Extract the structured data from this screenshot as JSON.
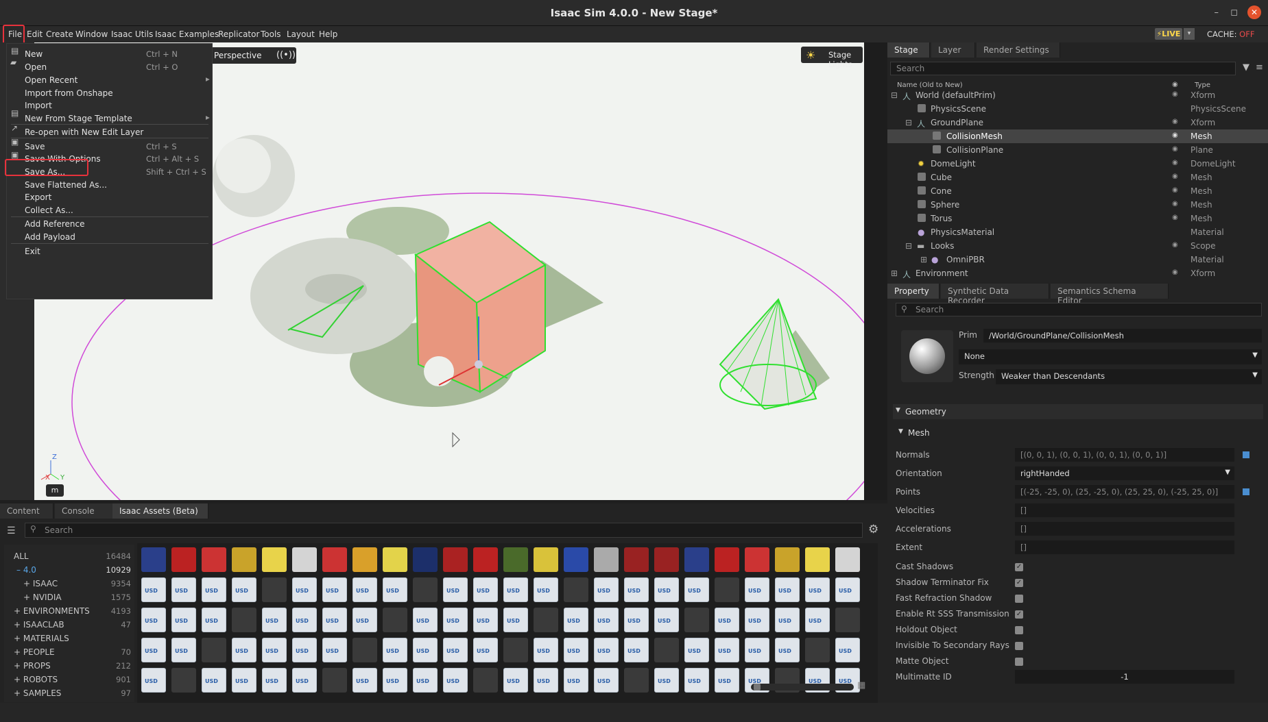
{
  "window": {
    "title": "Isaac Sim 4.0.0 - New Stage*",
    "min": "–",
    "max": "◻",
    "close": "✕"
  },
  "menubar": {
    "items": [
      "File",
      "Edit",
      "Create",
      "Window",
      "Isaac Utils",
      "Isaac Examples",
      "Replicator",
      "Tools",
      "Layout",
      "Help"
    ],
    "live": "⚡LIVE",
    "live_dd": "▾",
    "cache_label": "CACHE:",
    "cache_value": "OFF"
  },
  "file_menu": {
    "items": [
      {
        "label": "New",
        "shortcut": "Ctrl + N"
      },
      {
        "label": "Open",
        "shortcut": "Ctrl + O"
      },
      {
        "label": "Open Recent",
        "shortcut": "▸"
      },
      {
        "label": "Import from Onshape",
        "shortcut": ""
      },
      {
        "label": "Import",
        "shortcut": ""
      },
      {
        "label": "New From Stage Template",
        "shortcut": "▸"
      },
      {
        "label": "Re-open with New Edit Layer",
        "shortcut": ""
      },
      {
        "label": "Save",
        "shortcut": "Ctrl + S"
      },
      {
        "label": "Save With Options",
        "shortcut": "Ctrl + Alt + S"
      },
      {
        "label": "Save As...",
        "shortcut": "Shift + Ctrl + S"
      },
      {
        "label": "Save Flattened As...",
        "shortcut": ""
      },
      {
        "label": "Export",
        "shortcut": ""
      },
      {
        "label": "Collect As...",
        "shortcut": ""
      },
      {
        "label": "Add Reference",
        "shortcut": ""
      },
      {
        "label": "Add Payload",
        "shortcut": ""
      },
      {
        "label": "Exit",
        "shortcut": ""
      }
    ]
  },
  "viewport": {
    "camera": "Perspective",
    "lights": "Stage Lights",
    "units": "m",
    "axis_x": "X",
    "axis_y": "Y",
    "axis_z": "Z"
  },
  "stage": {
    "tabs": [
      "Stage",
      "Layer",
      "Render Settings"
    ],
    "search": "Search",
    "col_name": "Name (Old to New)",
    "col_type": "Type",
    "rows": [
      {
        "name": "World (defaultPrim)",
        "type": "Xform"
      },
      {
        "name": "PhysicsScene",
        "type": "PhysicsScene"
      },
      {
        "name": "GroundPlane",
        "type": "Xform"
      },
      {
        "name": "CollisionMesh",
        "type": "Mesh"
      },
      {
        "name": "CollisionPlane",
        "type": "Plane"
      },
      {
        "name": "DomeLight",
        "type": "DomeLight"
      },
      {
        "name": "Cube",
        "type": "Mesh"
      },
      {
        "name": "Cone",
        "type": "Mesh"
      },
      {
        "name": "Sphere",
        "type": "Mesh"
      },
      {
        "name": "Torus",
        "type": "Mesh"
      },
      {
        "name": "PhysicsMaterial",
        "type": "Material"
      },
      {
        "name": "Looks",
        "type": "Scope"
      },
      {
        "name": "OmniPBR",
        "type": "Material"
      },
      {
        "name": "Environment",
        "type": "Xform"
      }
    ]
  },
  "property": {
    "tabs": [
      "Property",
      "Synthetic Data Recorder",
      "Semantics Schema Editor"
    ],
    "search": "Search",
    "prim_label": "Prim",
    "prim_value": "/World/GroundPlane/CollisionMesh",
    "material": "None",
    "strength_label": "Strength",
    "strength_value": "Weaker than Descendants",
    "geometry": "Geometry",
    "mesh": "Mesh",
    "fields": [
      {
        "label": "Normals",
        "value": "[(0, 0, 1), (0, 0, 1), (0, 0, 1), (0, 0, 1)]"
      },
      {
        "label": "Orientation",
        "value": "rightHanded"
      },
      {
        "label": "Points",
        "value": "[(-25, -25, 0), (25, -25, 0), (25, 25, 0), (-25, 25, 0)]"
      },
      {
        "label": "Velocities",
        "value": "[]"
      },
      {
        "label": "Accelerations",
        "value": "[]"
      },
      {
        "label": "Extent",
        "value": "[]"
      }
    ],
    "checks": [
      {
        "label": "Cast Shadows",
        "checked": true
      },
      {
        "label": "Shadow Terminator Fix",
        "checked": true
      },
      {
        "label": "Fast Refraction Shadow",
        "checked": false
      },
      {
        "label": "Enable Rt SSS Transmission",
        "checked": true
      },
      {
        "label": "Holdout Object",
        "checked": false
      },
      {
        "label": "Invisible To Secondary Rays",
        "checked": false
      },
      {
        "label": "Matte Object",
        "checked": false
      }
    ],
    "multimatte_label": "Multimatte ID",
    "multimatte_value": "-1"
  },
  "bottom": {
    "tabs": [
      "Content",
      "Console",
      "Isaac Assets (Beta)"
    ],
    "search": "Search",
    "categories": [
      {
        "label": "ALL",
        "count": "16484"
      },
      {
        "label": "– 4.0",
        "count": "10929"
      },
      {
        "label": "+ ISAAC",
        "count": "9354"
      },
      {
        "label": "+ NVIDIA",
        "count": "1575"
      },
      {
        "label": "+ ENVIRONMENTS",
        "count": "4193"
      },
      {
        "label": "+ ISAACLAB",
        "count": "47"
      },
      {
        "label": "+ MATERIALS",
        "count": ""
      },
      {
        "label": "+ PEOPLE",
        "count": "70"
      },
      {
        "label": "+ PROPS",
        "count": "212"
      },
      {
        "label": "+ ROBOTS",
        "count": "901"
      },
      {
        "label": "+ SAMPLES",
        "count": "97"
      }
    ]
  },
  "colors": {
    "accent": "#e8323c",
    "selection": "#4a4a4a",
    "live": "#ffd84a"
  }
}
